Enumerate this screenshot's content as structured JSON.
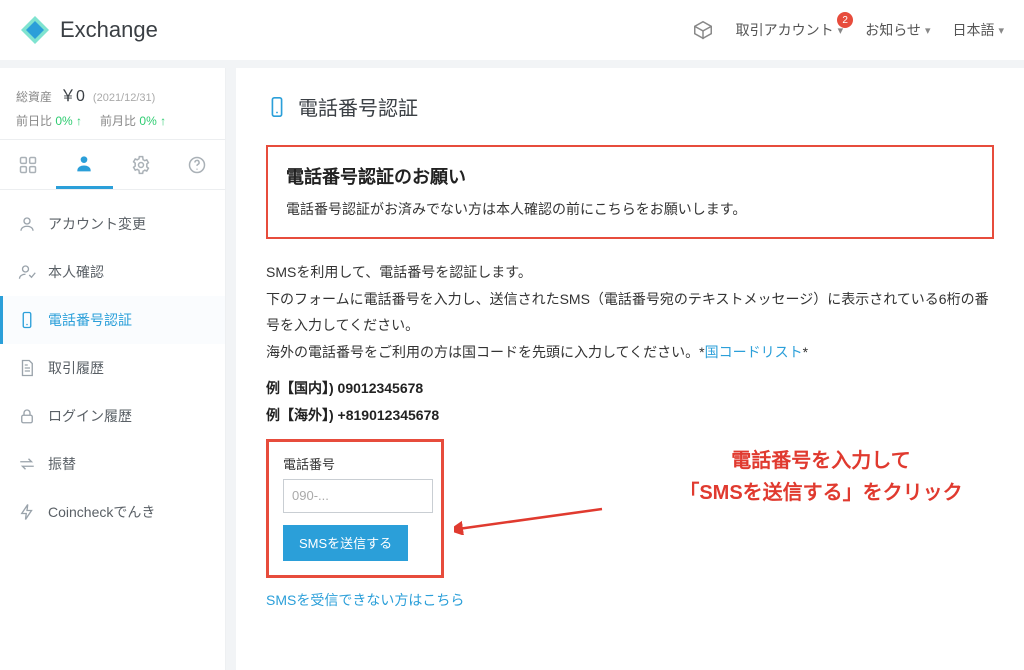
{
  "header": {
    "brand": "Exchange",
    "account_menu": "取引アカウント",
    "account_badge": "2",
    "notices_menu": "お知らせ",
    "language_menu": "日本語"
  },
  "sidebar": {
    "total_label": "総資産",
    "total_value": "￥0",
    "total_date": "(2021/12/31)",
    "dod_label": "前日比",
    "dod_value": "0% ↑",
    "mom_label": "前月比",
    "mom_value": "0% ↑",
    "items": [
      {
        "label": "アカウント変更"
      },
      {
        "label": "本人確認"
      },
      {
        "label": "電話番号認証"
      },
      {
        "label": "取引履歴"
      },
      {
        "label": "ログイン履歴"
      },
      {
        "label": "振替"
      },
      {
        "label": "Coincheckでんき"
      }
    ]
  },
  "main": {
    "page_title": "電話番号認証",
    "notice_title": "電話番号認証のお願い",
    "notice_text": "電話番号認証がお済みでない方は本人確認の前にこちらをお願いします。",
    "body_line1": "SMSを利用して、電話番号を認証します。",
    "body_line2": "下のフォームに電話番号を入力し、送信されたSMS（電話番号宛のテキストメッセージ）に表示されている6桁の番号を入力してください。",
    "body_line3_pre": "海外の電話番号をご利用の方は国コードを先頭に入力してください。*",
    "body_line3_link": "国コードリスト",
    "body_line3_post": "*",
    "example_domestic": "例【国内】) 09012345678",
    "example_intl": "例【海外】) +819012345678",
    "form_label": "電話番号",
    "phone_placeholder": "090-...",
    "sms_button": "SMSを送信する",
    "help_link": "SMSを受信できない方はこちら",
    "callout_text": "電話番号を入力して\n「SMSを送信する」をクリック"
  }
}
